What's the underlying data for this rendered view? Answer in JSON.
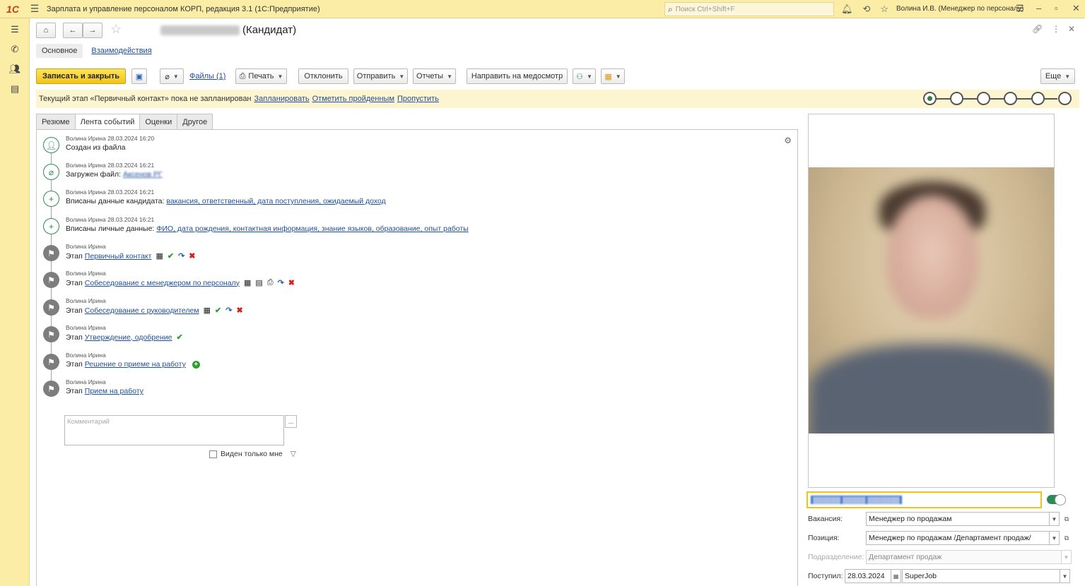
{
  "titlebar": {
    "logo": "1С",
    "app_title": "Зарплата и управление персоналом КОРП, редакция 3.1  (1С:Предприятие)",
    "search_placeholder": "Поиск Ctrl+Shift+F",
    "user": "Волина И.В. (Менеджер по персоналу)"
  },
  "form": {
    "title_suffix": "(Кандидат)",
    "nav_tabs": [
      "Основное",
      "Взаимодействия"
    ],
    "toolbar": {
      "save_close": "Записать и закрыть",
      "files": "Файлы (1)",
      "print": "Печать",
      "reject": "Отклонить",
      "send": "Отправить",
      "reports": "Отчеты",
      "medical": "Направить на медосмотр",
      "more": "Еще"
    },
    "stagebar": {
      "text": "Текущий этап «Первичный контакт» пока не запланирован",
      "plan": "Запланировать",
      "mark_done": "Отметить пройденным",
      "skip": "Пропустить"
    },
    "tabs": [
      "Резюме",
      "Лента событий",
      "Оценки",
      "Другое"
    ]
  },
  "feed": {
    "events": [
      {
        "meta": "Волина Ирина 28.03.2024 16:20",
        "text": "Создан из файла",
        "link": ""
      },
      {
        "meta": "Волина Ирина 28.03.2024 16:21",
        "text": "Загружен файл:",
        "link": "Аксенов РГ"
      },
      {
        "meta": "Волина Ирина 28.03.2024 16:21",
        "text": "Вписаны данные кандидата:",
        "link": "вакансия, ответственный, дата поступления, ожидаемый доход"
      },
      {
        "meta": "Волина Ирина 28.03.2024 16:21",
        "text": "Вписаны личные данные:",
        "link": "ФИО, дата рождения, контактная информация, знание языков, образование, опыт работы"
      },
      {
        "meta": "Волина Ирина",
        "text": "Этап",
        "link": "Первичный контакт"
      },
      {
        "meta": "Волина Ирина",
        "text": "Этап",
        "link": "Собеседование с менеджером по персоналу"
      },
      {
        "meta": "Волина Ирина",
        "text": "Этап",
        "link": "Собеседование с руководителем"
      },
      {
        "meta": "Волина Ирина",
        "text": "Этап",
        "link": "Утверждение, одобрение"
      },
      {
        "meta": "Волина Ирина",
        "text": "Этап",
        "link": "Решение о приеме на работу"
      },
      {
        "meta": "Волина Ирина",
        "text": "Этап",
        "link": "Прием на работу"
      }
    ],
    "comment_placeholder": "Комментарий",
    "comment_more": "...",
    "visible_only_me": "Виден только мне"
  },
  "right": {
    "fields": {
      "vacancy_label": "Вакансия:",
      "vacancy_value": "Менеджер  по продажам",
      "position_label": "Позиция:",
      "position_value": "Менеджер по продажам /Департамент продаж/",
      "department_label": "Подразделение:",
      "department_value": "Департамент продаж",
      "received_label": "Поступил:",
      "received_date": "28.03.2024",
      "received_source": "SuperJob"
    }
  }
}
